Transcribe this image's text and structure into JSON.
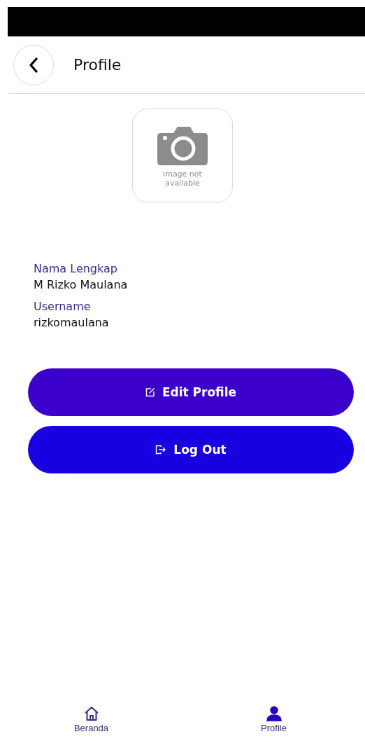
{
  "header": {
    "title": "Profile"
  },
  "avatar": {
    "caption": "image not available"
  },
  "fields": [
    {
      "label": "Nama Lengkap",
      "value": "M Rizko Maulana"
    },
    {
      "label": "Username",
      "value": "rizkomaulana"
    }
  ],
  "buttons": [
    {
      "kind": "edit",
      "label": "Edit Profile",
      "color": "#3c00cc"
    },
    {
      "kind": "logout",
      "label": "Log Out",
      "color": "#1800e0"
    }
  ],
  "nav": [
    {
      "kind": "home",
      "label": "Beranda",
      "selected": false
    },
    {
      "kind": "person",
      "label": "Profile",
      "selected": true
    }
  ]
}
